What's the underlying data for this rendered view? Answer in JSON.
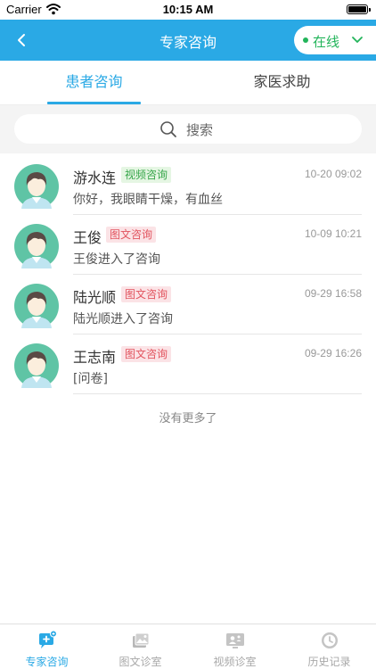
{
  "status_bar": {
    "carrier": "Carrier",
    "time": "10:15 AM"
  },
  "nav": {
    "title": "专家咨询",
    "status_label": "在线",
    "status_color": "#22b45a"
  },
  "tabs": [
    {
      "label": "患者咨询",
      "active": true
    },
    {
      "label": "家医求助",
      "active": false
    }
  ],
  "search": {
    "placeholder": "搜索"
  },
  "consultations": [
    {
      "name": "游水连",
      "tag": "视频咨询",
      "tag_type": "video",
      "time": "10-20 09:02",
      "preview": "你好，我眼睛干燥，有血丝"
    },
    {
      "name": "王俊",
      "tag": "图文咨询",
      "tag_type": "text",
      "time": "10-09 10:21",
      "preview": "王俊进入了咨询"
    },
    {
      "name": "陆光顺",
      "tag": "图文咨询",
      "tag_type": "text",
      "time": "09-29 16:58",
      "preview": "陆光顺进入了咨询"
    },
    {
      "name": "王志南",
      "tag": "图文咨询",
      "tag_type": "text",
      "time": "09-29 16:26",
      "preview": "[问卷]"
    }
  ],
  "list_footer": "没有更多了",
  "bottom_tabs": [
    {
      "label": "专家咨询",
      "icon": "chat-add-icon",
      "active": true
    },
    {
      "label": "图文诊室",
      "icon": "image-room-icon",
      "active": false
    },
    {
      "label": "视频诊室",
      "icon": "video-room-icon",
      "active": false
    },
    {
      "label": "历史记录",
      "icon": "history-icon",
      "active": false
    }
  ],
  "colors": {
    "accent": "#2aa9e5",
    "video_tag": "#37a64a",
    "text_tag": "#e2545f"
  }
}
